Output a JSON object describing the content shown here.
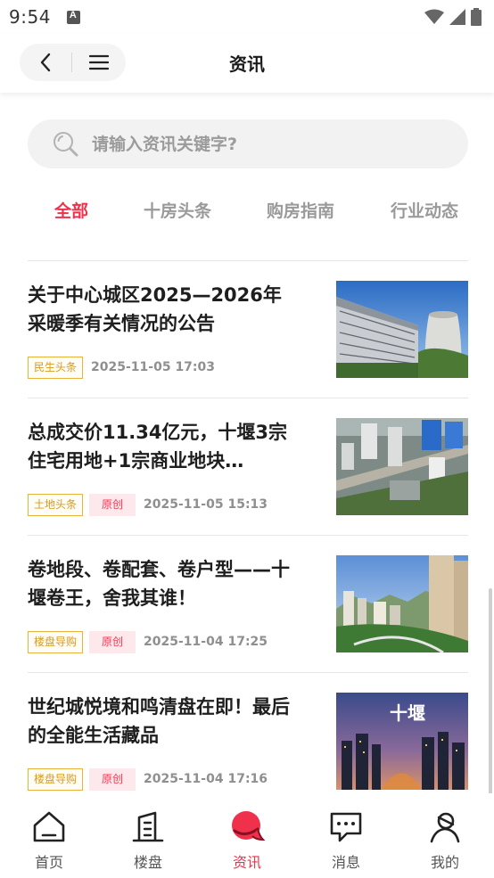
{
  "status_bar": {
    "time": "9:54"
  },
  "header": {
    "title": "资讯"
  },
  "search": {
    "placeholder": "请输入资讯关键字?"
  },
  "tabs": [
    {
      "label": "全部",
      "active": true
    },
    {
      "label": "十房头条",
      "active": false
    },
    {
      "label": "购房指南",
      "active": false
    },
    {
      "label": "行业动态",
      "active": false
    }
  ],
  "news": [
    {
      "title": "关于中心城区2025—2026年采暖季有关情况的公告",
      "category": "民生头条",
      "original": "",
      "date": "2025-11-05 17:03",
      "thumb": "building-icon"
    },
    {
      "title": "总成交价11.34亿元，十堰3宗住宅用地+1宗商业地块…",
      "category": "土地头条",
      "original": "原创",
      "date": "2025-11-05 15:13",
      "thumb": "aerial-city-icon"
    },
    {
      "title": "卷地段、卷配套、卷户型——十堰卷王，舍我其谁！",
      "category": "楼盘导购",
      "original": "原创",
      "date": "2025-11-04 17:25",
      "thumb": "city-skyline-icon"
    },
    {
      "title": "世纪城悦境和鸣清盘在即！最后的全能生活藏品",
      "category": "楼盘导购",
      "original": "原创",
      "date": "2025-11-04 17:16",
      "thumb": "night-city-icon",
      "thumb_text": "十堰"
    }
  ],
  "bottom_nav": [
    {
      "label": "首页",
      "icon": "home-icon",
      "active": false
    },
    {
      "label": "楼盘",
      "icon": "building-icon",
      "active": false
    },
    {
      "label": "资讯",
      "icon": "news-chat-icon",
      "active": true
    },
    {
      "label": "消息",
      "icon": "message-icon",
      "active": false
    },
    {
      "label": "我的",
      "icon": "user-icon",
      "active": false
    }
  ],
  "colors": {
    "accent": "#f0314b",
    "category_tag": "#e8b23c",
    "original_tag_bg": "#fde9ec"
  }
}
